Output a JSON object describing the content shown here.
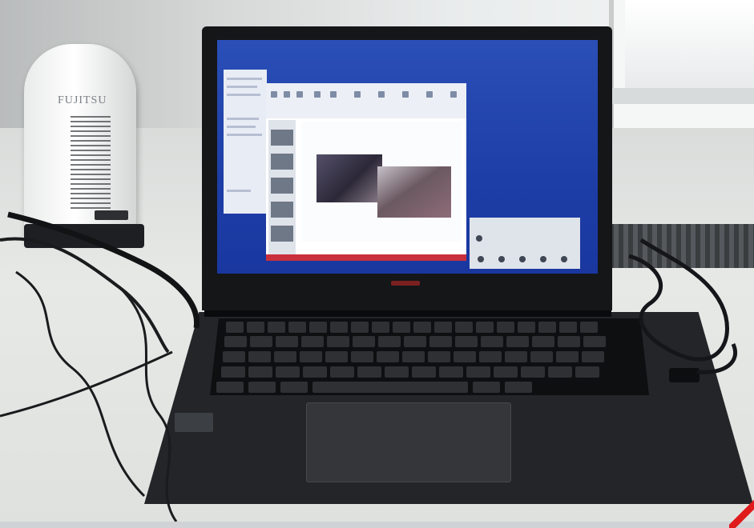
{
  "scene": {
    "description_free": true,
    "dock_brand": "FUJITSU",
    "colors": {
      "desktop": "#1d3ea6",
      "laptop_body": "#232528",
      "accent_status": "#c9303c"
    },
    "icons": [
      "cable-icon",
      "laptop-icon",
      "docking-station-icon"
    ]
  }
}
